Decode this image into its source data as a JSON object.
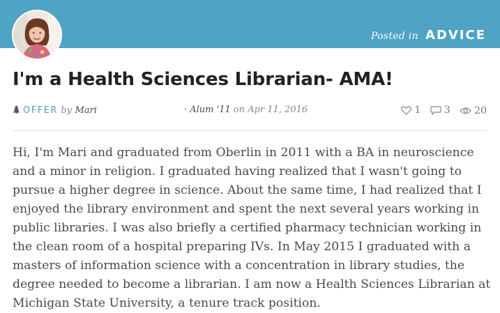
{
  "header": {
    "posted_in_label": "Posted in",
    "category": "ADVICE",
    "bar_color": "#4fa3c4"
  },
  "post": {
    "title": "I'm a Health Sciences Librarian- AMA!",
    "type_icon": "tree-icon",
    "type": "OFFER",
    "by_label": "by",
    "author": "Mari",
    "alum_line": "· Alum '11",
    "on_label": "on",
    "date": "Apr 11, 2016",
    "likes": "1",
    "comments": "3",
    "views": "20",
    "body": "Hi, I'm Mari and graduated from Oberlin in 2011 with a BA in neuroscience and a minor in religion. I graduated having realized that I wasn't going to pursue a higher degree in science. About the same time, I had realized that I enjoyed the library environment and spent the next several years working in public libraries. I was also briefly a certified pharmacy technician working in the clean room of a hospital preparing IVs. In May 2015 I graduated with a masters of information science with a concentration in library studies, the degree needed to become a librarian. I am now a Health Sciences Librarian at Michigan State University, a tenure track position."
  },
  "icons": {
    "likes": "heart-icon",
    "comments": "comment-icon",
    "views": "eye-icon"
  },
  "colors": {
    "accent": "#4fa3c4",
    "title": "#222222",
    "text": "#4a4a4a",
    "muted": "#888888"
  }
}
